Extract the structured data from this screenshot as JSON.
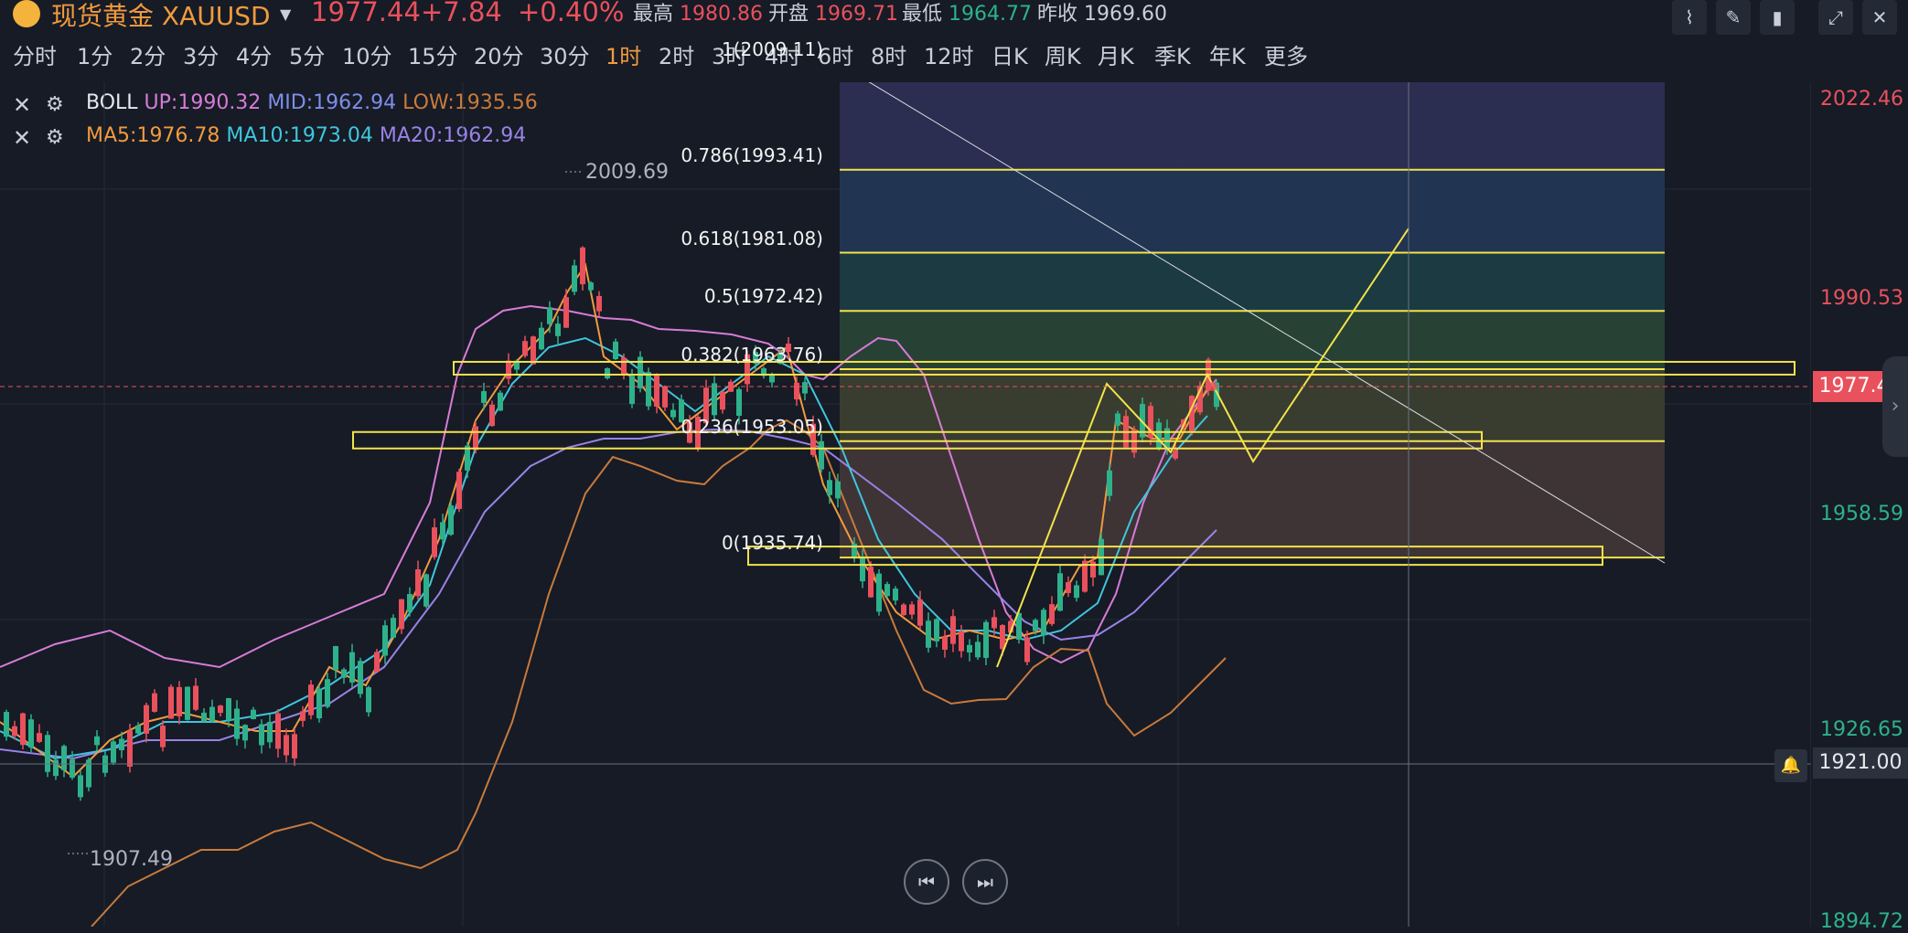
{
  "header": {
    "symbol_cn": "现货黄金",
    "symbol": "XAUUSD",
    "price": "1977.44",
    "change": "+7.84",
    "change_pct": "+0.40%",
    "high_label": "最高",
    "high": "1980.86",
    "open_label": "开盘",
    "open": "1969.71",
    "low_label": "最低",
    "low": "1964.77",
    "prev_close_label": "昨收",
    "prev_close": "1969.60"
  },
  "periods": [
    "分时",
    "1分",
    "2分",
    "3分",
    "4分",
    "5分",
    "10分",
    "15分",
    "20分",
    "30分",
    "1时",
    "2时",
    "3时",
    "4时",
    "6时",
    "8时",
    "12时",
    "日K",
    "周K",
    "月K",
    "季K",
    "年K",
    "更多"
  ],
  "active_period": "1时",
  "indicators": {
    "boll": {
      "name": "BOLL",
      "up": "UP:1990.32",
      "mid": "MID:1962.94",
      "low": "LOW:1935.56"
    },
    "ma": {
      "ma5": "MA5:1976.78",
      "ma10": "MA10:1973.04",
      "ma20": "MA20:1962.94"
    }
  },
  "fib_levels": [
    {
      "label": "1(2009.11)",
      "price": 2009.11
    },
    {
      "label": "0.786(1993.41)",
      "price": 1993.41
    },
    {
      "label": "0.618(1981.08)",
      "price": 1981.08
    },
    {
      "label": "0.5(1972.42)",
      "price": 1972.42
    },
    {
      "label": "0.382(1963.76)",
      "price": 1963.76
    },
    {
      "label": "0.236(1953.05)",
      "price": 1953.05
    },
    {
      "label": "0(1935.74)",
      "price": 1935.74
    }
  ],
  "annotations": {
    "high": "2009.69",
    "low": "1907.49"
  },
  "price_axis": [
    {
      "text": "2022.46",
      "color": "#e9515c"
    },
    {
      "text": "1990.53",
      "color": "#e9515c"
    },
    {
      "text": "1958.59",
      "color": "#2eb18a"
    },
    {
      "text": "1926.65",
      "color": "#2eb18a"
    },
    {
      "text": "1894.72",
      "color": "#2eb18a"
    }
  ],
  "current_price_tag": "1977.44",
  "crosshair_price_tag": "1921.00",
  "colors": {
    "up": "#e9515c",
    "down": "#2eb18a",
    "accent": "#f19a3e",
    "fib": "#f2e34a",
    "boll_up": "#d77bd6",
    "boll_low": "#c97a3b",
    "ma5": "#f19a3e",
    "ma10": "#3fc6dc",
    "ma20": "#9a82e6"
  },
  "icons": [
    "gold-icon",
    "chevron-down-icon",
    "line-tool-icon",
    "pen-icon",
    "candle-icon",
    "expand-icon",
    "close-icon",
    "close-x-icon",
    "gear-icon",
    "prev-icon",
    "next-icon",
    "bell-icon",
    "chevron-right-icon"
  ]
}
